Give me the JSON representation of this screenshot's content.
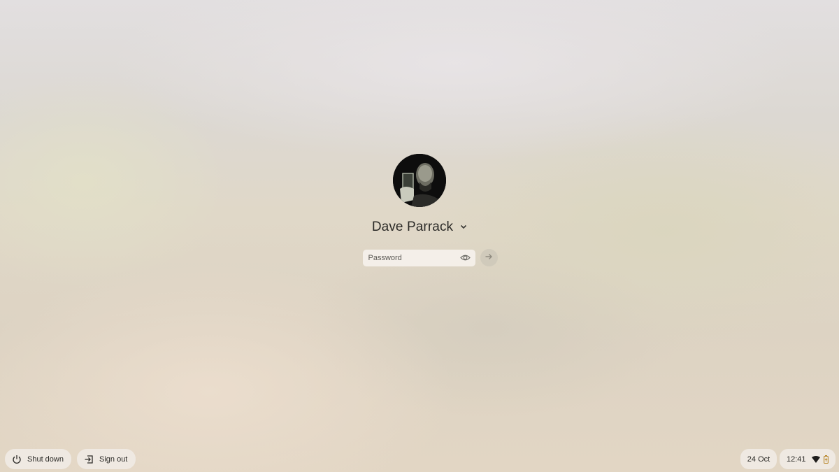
{
  "user": {
    "name": "Dave Parrack",
    "avatar_icon": "user-avatar-photo",
    "switch_user_icon": "chevron-down-icon"
  },
  "password": {
    "value": "",
    "placeholder": "Password",
    "show_password_icon": "eye-icon",
    "submit_icon": "arrow-right-icon"
  },
  "shelf": {
    "shutdown_label": "Shut down",
    "signout_label": "Sign out",
    "date": "24 Oct",
    "time": "12:41",
    "wifi_icon": "wifi-icon",
    "battery_icon": "battery-icon"
  },
  "colors": {
    "battery": "#b8862a",
    "text": "#2b2a27"
  }
}
